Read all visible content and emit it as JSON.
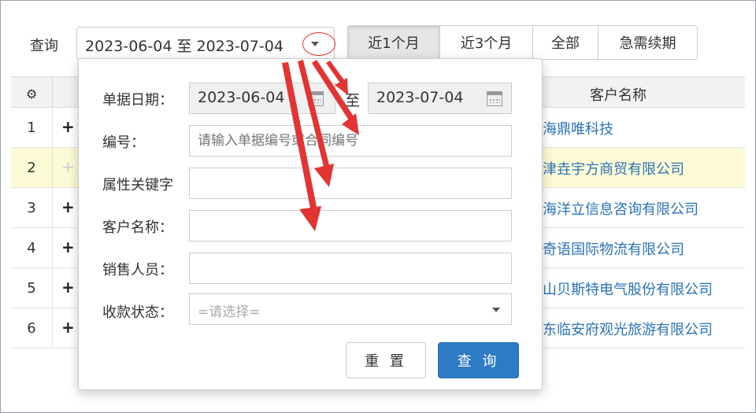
{
  "query_bar": {
    "label": "查询",
    "date_range": "2023-06-04 至 2023-07-04",
    "quick_ranges": [
      {
        "label": "近1个月",
        "active": true
      },
      {
        "label": "近3个月",
        "active": false
      },
      {
        "label": "全部",
        "active": false
      },
      {
        "label": "急需续期",
        "active": false
      }
    ]
  },
  "table": {
    "header_customer": "客户名称",
    "rows": [
      {
        "index": "1",
        "expand": "+",
        "customer": "海鼎唯科技",
        "highlight": false
      },
      {
        "index": "2",
        "expand": "+",
        "customer": "津垚宇方商贸有限公司",
        "highlight": true
      },
      {
        "index": "3",
        "expand": "+",
        "customer": "海洋立信息咨询有限公司",
        "highlight": false
      },
      {
        "index": "4",
        "expand": "+",
        "customer": "奇语国际物流有限公司",
        "highlight": false
      },
      {
        "index": "5",
        "expand": "+",
        "customer": "山贝斯特电气股份有限公司",
        "highlight": false
      },
      {
        "index": "6",
        "expand": "+",
        "customer": "东临安府观光旅游有限公司",
        "highlight": false
      }
    ]
  },
  "filter_panel": {
    "doc_date_label": "单据日期：",
    "date_from": "2023-06-04",
    "date_sep": "至",
    "date_to": "2023-07-04",
    "number_label": "编号：",
    "number_placeholder": "请输入单据编号或合同编号",
    "attr_label": "属性关键字",
    "attr_value": "",
    "customer_label": "客户名称：",
    "customer_value": "",
    "sales_label": "销售人员：",
    "sales_value": "",
    "payment_label": "收款状态：",
    "payment_selected": "=请选择=",
    "reset_button": "重 置",
    "query_button": "查 询"
  },
  "colors": {
    "primary": "#2d7bc4",
    "link": "#2a73b8",
    "annotation": "#e33333",
    "row_highlight": "#fdfbd6"
  }
}
